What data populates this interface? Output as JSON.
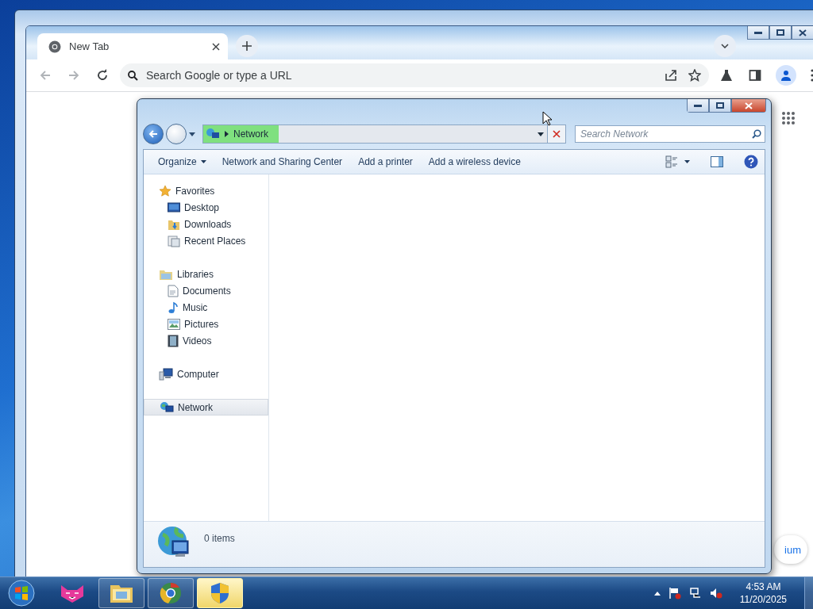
{
  "chrome": {
    "tabs": [
      {
        "title": "New Tab",
        "selected": true
      }
    ],
    "omnibox": {
      "placeholder": "Search Google or type a URL"
    },
    "corner_chip": {
      "text": "ium"
    }
  },
  "explorer": {
    "address": {
      "crumbs": [
        "Network"
      ]
    },
    "search": {
      "placeholder": "Search Network"
    },
    "toolbar": [
      {
        "label": "Organize",
        "kind": "menu"
      },
      {
        "label": "Network and Sharing Center",
        "kind": "button"
      },
      {
        "label": "Add a printer",
        "kind": "button"
      },
      {
        "label": "Add a wireless device",
        "kind": "button"
      }
    ],
    "nav": [
      {
        "label": "Favorites",
        "kind": "star",
        "selected": false,
        "children": [
          {
            "label": "Desktop",
            "kind": "desktop",
            "selected": false
          },
          {
            "label": "Downloads",
            "kind": "downloads",
            "selected": false
          },
          {
            "label": "Recent Places",
            "kind": "recent",
            "selected": false
          }
        ]
      },
      {
        "label": "Libraries",
        "kind": "libraries",
        "selected": false,
        "children": [
          {
            "label": "Documents",
            "kind": "documents",
            "selected": false
          },
          {
            "label": "Music",
            "kind": "music",
            "selected": false
          },
          {
            "label": "Pictures",
            "kind": "pictures",
            "selected": false
          },
          {
            "label": "Videos",
            "kind": "videos",
            "selected": false
          }
        ]
      },
      {
        "label": "Computer",
        "kind": "computer",
        "selected": false
      },
      {
        "label": "Network",
        "kind": "network",
        "selected": true
      }
    ],
    "status": {
      "text": "0 items"
    }
  },
  "taskbar": {
    "buttons": [
      {
        "kind": "cat",
        "selected": false,
        "running": false
      },
      {
        "kind": "folder",
        "selected": false,
        "running": true
      },
      {
        "kind": "browser",
        "selected": false,
        "running": true
      },
      {
        "kind": "shield",
        "selected": true,
        "running": true
      }
    ],
    "clock": {
      "time": "4:53 AM",
      "date": "11/20/2025"
    }
  }
}
